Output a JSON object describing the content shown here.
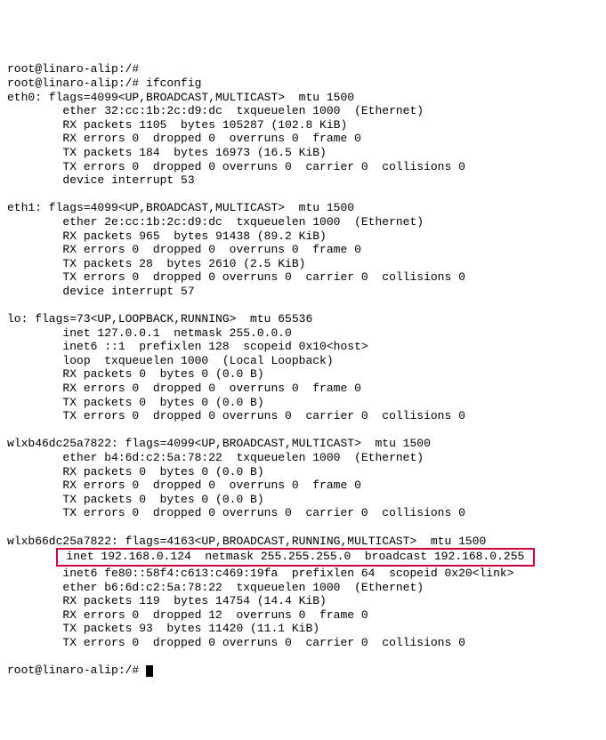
{
  "prompt1": "root@linaro-alip:/#",
  "prompt2": "root@linaro-alip:/# ifconfig",
  "eth0": {
    "header": "eth0: flags=4099<UP,BROADCAST,MULTICAST>  mtu 1500",
    "ether": "        ether 32:cc:1b:2c:d9:dc  txqueuelen 1000  (Ethernet)",
    "rx_packets": "        RX packets 1105  bytes 105287 (102.8 KiB)",
    "rx_errors": "        RX errors 0  dropped 0  overruns 0  frame 0",
    "tx_packets": "        TX packets 184  bytes 16973 (16.5 KiB)",
    "tx_errors": "        TX errors 0  dropped 0 overruns 0  carrier 0  collisions 0",
    "interrupt": "        device interrupt 53"
  },
  "eth1": {
    "header": "eth1: flags=4099<UP,BROADCAST,MULTICAST>  mtu 1500",
    "ether": "        ether 2e:cc:1b:2c:d9:dc  txqueuelen 1000  (Ethernet)",
    "rx_packets": "        RX packets 965  bytes 91438 (89.2 KiB)",
    "rx_errors": "        RX errors 0  dropped 0  overruns 0  frame 0",
    "tx_packets": "        TX packets 28  bytes 2610 (2.5 KiB)",
    "tx_errors": "        TX errors 0  dropped 0 overruns 0  carrier 0  collisions 0",
    "interrupt": "        device interrupt 57"
  },
  "lo": {
    "header": "lo: flags=73<UP,LOOPBACK,RUNNING>  mtu 65536",
    "inet": "        inet 127.0.0.1  netmask 255.0.0.0",
    "inet6": "        inet6 ::1  prefixlen 128  scopeid 0x10<host>",
    "loop": "        loop  txqueuelen 1000  (Local Loopback)",
    "rx_packets": "        RX packets 0  bytes 0 (0.0 B)",
    "rx_errors": "        RX errors 0  dropped 0  overruns 0  frame 0",
    "tx_packets": "        TX packets 0  bytes 0 (0.0 B)",
    "tx_errors": "        TX errors 0  dropped 0 overruns 0  carrier 0  collisions 0"
  },
  "wlxb46": {
    "header": "wlxb46dc25a7822: flags=4099<UP,BROADCAST,MULTICAST>  mtu 1500",
    "ether": "        ether b4:6d:c2:5a:78:22  txqueuelen 1000  (Ethernet)",
    "rx_packets": "        RX packets 0  bytes 0 (0.0 B)",
    "rx_errors": "        RX errors 0  dropped 0  overruns 0  frame 0",
    "tx_packets": "        TX packets 0  bytes 0 (0.0 B)",
    "tx_errors": "        TX errors 0  dropped 0 overruns 0  carrier 0  collisions 0"
  },
  "wlxb66": {
    "header": "wlxb66dc25a7822: flags=4163<UP,BROADCAST,RUNNING,MULTICAST>  mtu 1500",
    "inet_pad": "       ",
    "inet": " inet 192.168.0.124  netmask 255.255.255.0  broadcast 192.168.0.255 ",
    "inet6": "        inet6 fe80::58f4:c613:c469:19fa  prefixlen 64  scopeid 0x20<link>",
    "ether": "        ether b6:6d:c2:5a:78:22  txqueuelen 1000  (Ethernet)",
    "rx_packets": "        RX packets 119  bytes 14754 (14.4 KiB)",
    "rx_errors": "        RX errors 0  dropped 12  overruns 0  frame 0",
    "tx_packets": "        TX packets 93  bytes 11420 (11.1 KiB)",
    "tx_errors": "        TX errors 0  dropped 0 overruns 0  carrier 0  collisions 0"
  },
  "prompt3": "root@linaro-alip:/# "
}
